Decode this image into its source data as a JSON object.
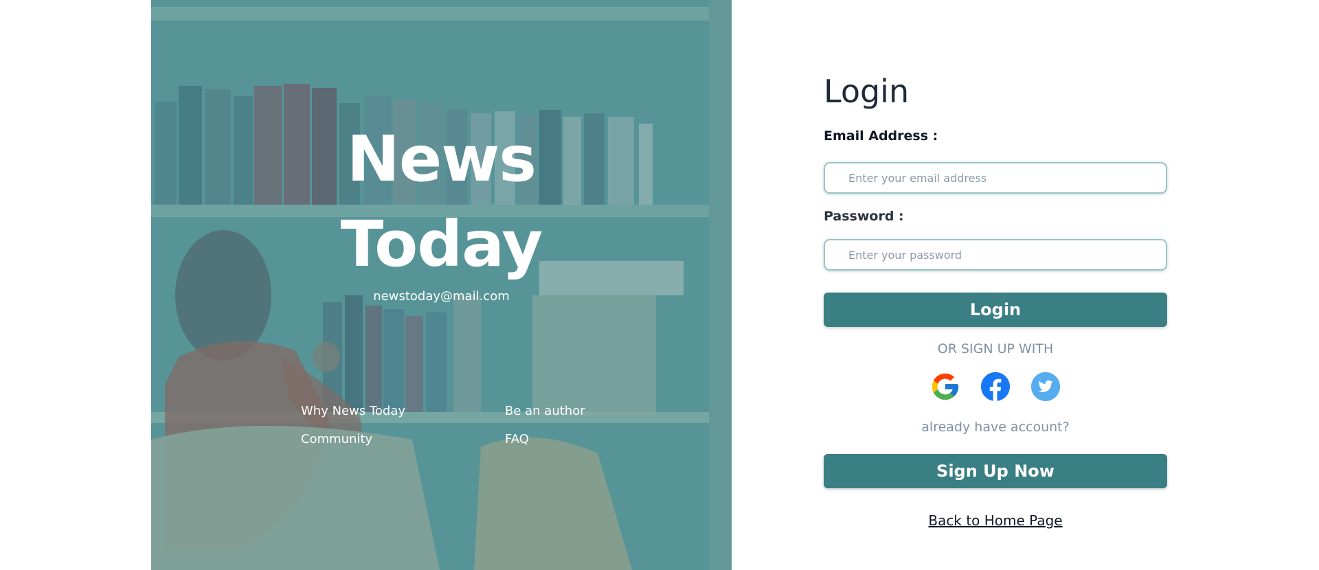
{
  "hero": {
    "brand_line1": "News",
    "brand_line2": "Today",
    "email": "newstoday@mail.com",
    "links": [
      "Why News Today",
      "Be an author",
      "Community",
      "FAQ"
    ]
  },
  "login": {
    "title": "Login",
    "email_label": "Email Address :",
    "email_placeholder": "Enter your email address",
    "password_label": "Password :",
    "password_placeholder": "Enter your password",
    "login_button": "Login",
    "or_signup_text": "OR SIGN UP WITH",
    "social_icons": [
      "google-icon",
      "facebook-icon",
      "twitter-icon"
    ],
    "already_account_text": "already have account?",
    "signup_button": "Sign Up Now",
    "back_link": "Back to Home Page"
  },
  "colors": {
    "accent": "#3a7f84",
    "muted_text": "#8090a2",
    "hero_overlay": "#6cacae",
    "facebook": "#1877f2",
    "twitter": "#55acee"
  }
}
